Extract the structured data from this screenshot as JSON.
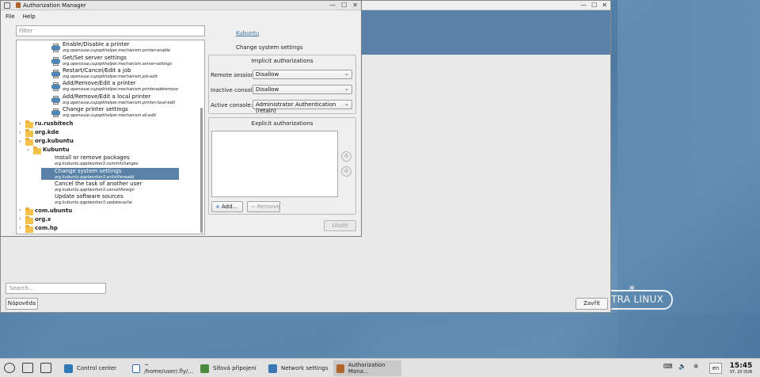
{
  "window": {
    "title": "Authorization Manager",
    "menu": [
      "File",
      "Help"
    ]
  },
  "filter": {
    "placeholder": "Filter"
  },
  "tree": {
    "printer_actions": [
      {
        "name": "Enable/Disable a printer",
        "id": "org.opensuse.cupspkhelper.mechanism.printer-enable"
      },
      {
        "name": "Get/Set server settings",
        "id": "org.opensuse.cupspkhelper.mechanism.server-settings"
      },
      {
        "name": "Restart/Cancel/Edit a job",
        "id": "org.opensuse.cupspkhelper.mechanism.job-edit"
      },
      {
        "name": "Add/Remove/Edit a printer",
        "id": "org.opensuse.cupspkhelper.mechanism.printeraddremove"
      },
      {
        "name": "Add/Remove/Edit a local printer",
        "id": "org.opensuse.cupspkhelper.mechanism.printer-local-edit"
      },
      {
        "name": "Change printer settings",
        "id": "org.opensuse.cupspkhelper.mechanism.all-edit"
      }
    ],
    "folders": {
      "rusbitech": "ru.rusbitech",
      "kde": "org.kde",
      "kubuntu": "org.kubuntu",
      "kubuntu_sub": "Kubuntu",
      "com_ubuntu": "com.ubuntu",
      "org_x": "org.x",
      "com_hp": "com.hp"
    },
    "kubuntu_actions": [
      {
        "name": "Install or remove packages",
        "id": "org.kubuntu.qaptworker3.commitchanges"
      },
      {
        "name": "Change system settings",
        "id": "org.kubuntu.qaptworker3.writefilereadd"
      },
      {
        "name": "Cancel the task of another user",
        "id": "org.kubuntu.qaptworker3.canceliforeign"
      },
      {
        "name": "Update software sources",
        "id": "org.kubuntu.qaptworker3.updatecache"
      }
    ]
  },
  "details": {
    "vendor_link": "Kubuntu",
    "action_title": "Change system settings",
    "implicit_title": "Implicit authorizations",
    "remote_label": "Remote session:",
    "remote_value": "Disallow",
    "inactive_label": "Inactive console:",
    "inactive_value": "Disallow",
    "active_label": "Active console:",
    "active_value": "Administrator Authentication (retain)",
    "explicit_title": "Explicit authorizations",
    "add_label": "Add...",
    "remove_label": "Remove",
    "save_label": "Uložit"
  },
  "background_window": {
    "search_placeholder": "Search...",
    "help_label": "Nápověda",
    "close_label": "Zavřít"
  },
  "desktop": {
    "logo_text": "TRA LINUX"
  },
  "taskbar": {
    "tasks": [
      {
        "label": "Control center"
      },
      {
        "label": "~ /home/user/.fly/..."
      },
      {
        "label": "Síťová připojení"
      },
      {
        "label": "Network settings"
      },
      {
        "label": "Authorization Mana..."
      }
    ],
    "lang": "en",
    "time": "15:45",
    "date": "ST, 20 DUB"
  }
}
